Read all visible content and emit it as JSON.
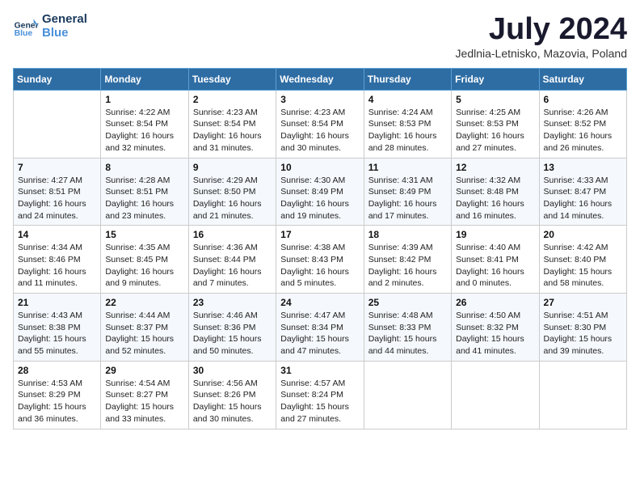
{
  "logo": {
    "line1": "General",
    "line2": "Blue"
  },
  "title": "July 2024",
  "location": "Jedlnia-Letnisko, Mazovia, Poland",
  "days_header": [
    "Sunday",
    "Monday",
    "Tuesday",
    "Wednesday",
    "Thursday",
    "Friday",
    "Saturday"
  ],
  "weeks": [
    [
      {
        "num": "",
        "info": ""
      },
      {
        "num": "1",
        "info": "Sunrise: 4:22 AM\nSunset: 8:54 PM\nDaylight: 16 hours\nand 32 minutes."
      },
      {
        "num": "2",
        "info": "Sunrise: 4:23 AM\nSunset: 8:54 PM\nDaylight: 16 hours\nand 31 minutes."
      },
      {
        "num": "3",
        "info": "Sunrise: 4:23 AM\nSunset: 8:54 PM\nDaylight: 16 hours\nand 30 minutes."
      },
      {
        "num": "4",
        "info": "Sunrise: 4:24 AM\nSunset: 8:53 PM\nDaylight: 16 hours\nand 28 minutes."
      },
      {
        "num": "5",
        "info": "Sunrise: 4:25 AM\nSunset: 8:53 PM\nDaylight: 16 hours\nand 27 minutes."
      },
      {
        "num": "6",
        "info": "Sunrise: 4:26 AM\nSunset: 8:52 PM\nDaylight: 16 hours\nand 26 minutes."
      }
    ],
    [
      {
        "num": "7",
        "info": "Sunrise: 4:27 AM\nSunset: 8:51 PM\nDaylight: 16 hours\nand 24 minutes."
      },
      {
        "num": "8",
        "info": "Sunrise: 4:28 AM\nSunset: 8:51 PM\nDaylight: 16 hours\nand 23 minutes."
      },
      {
        "num": "9",
        "info": "Sunrise: 4:29 AM\nSunset: 8:50 PM\nDaylight: 16 hours\nand 21 minutes."
      },
      {
        "num": "10",
        "info": "Sunrise: 4:30 AM\nSunset: 8:49 PM\nDaylight: 16 hours\nand 19 minutes."
      },
      {
        "num": "11",
        "info": "Sunrise: 4:31 AM\nSunset: 8:49 PM\nDaylight: 16 hours\nand 17 minutes."
      },
      {
        "num": "12",
        "info": "Sunrise: 4:32 AM\nSunset: 8:48 PM\nDaylight: 16 hours\nand 16 minutes."
      },
      {
        "num": "13",
        "info": "Sunrise: 4:33 AM\nSunset: 8:47 PM\nDaylight: 16 hours\nand 14 minutes."
      }
    ],
    [
      {
        "num": "14",
        "info": "Sunrise: 4:34 AM\nSunset: 8:46 PM\nDaylight: 16 hours\nand 11 minutes."
      },
      {
        "num": "15",
        "info": "Sunrise: 4:35 AM\nSunset: 8:45 PM\nDaylight: 16 hours\nand 9 minutes."
      },
      {
        "num": "16",
        "info": "Sunrise: 4:36 AM\nSunset: 8:44 PM\nDaylight: 16 hours\nand 7 minutes."
      },
      {
        "num": "17",
        "info": "Sunrise: 4:38 AM\nSunset: 8:43 PM\nDaylight: 16 hours\nand 5 minutes."
      },
      {
        "num": "18",
        "info": "Sunrise: 4:39 AM\nSunset: 8:42 PM\nDaylight: 16 hours\nand 2 minutes."
      },
      {
        "num": "19",
        "info": "Sunrise: 4:40 AM\nSunset: 8:41 PM\nDaylight: 16 hours\nand 0 minutes."
      },
      {
        "num": "20",
        "info": "Sunrise: 4:42 AM\nSunset: 8:40 PM\nDaylight: 15 hours\nand 58 minutes."
      }
    ],
    [
      {
        "num": "21",
        "info": "Sunrise: 4:43 AM\nSunset: 8:38 PM\nDaylight: 15 hours\nand 55 minutes."
      },
      {
        "num": "22",
        "info": "Sunrise: 4:44 AM\nSunset: 8:37 PM\nDaylight: 15 hours\nand 52 minutes."
      },
      {
        "num": "23",
        "info": "Sunrise: 4:46 AM\nSunset: 8:36 PM\nDaylight: 15 hours\nand 50 minutes."
      },
      {
        "num": "24",
        "info": "Sunrise: 4:47 AM\nSunset: 8:34 PM\nDaylight: 15 hours\nand 47 minutes."
      },
      {
        "num": "25",
        "info": "Sunrise: 4:48 AM\nSunset: 8:33 PM\nDaylight: 15 hours\nand 44 minutes."
      },
      {
        "num": "26",
        "info": "Sunrise: 4:50 AM\nSunset: 8:32 PM\nDaylight: 15 hours\nand 41 minutes."
      },
      {
        "num": "27",
        "info": "Sunrise: 4:51 AM\nSunset: 8:30 PM\nDaylight: 15 hours\nand 39 minutes."
      }
    ],
    [
      {
        "num": "28",
        "info": "Sunrise: 4:53 AM\nSunset: 8:29 PM\nDaylight: 15 hours\nand 36 minutes."
      },
      {
        "num": "29",
        "info": "Sunrise: 4:54 AM\nSunset: 8:27 PM\nDaylight: 15 hours\nand 33 minutes."
      },
      {
        "num": "30",
        "info": "Sunrise: 4:56 AM\nSunset: 8:26 PM\nDaylight: 15 hours\nand 30 minutes."
      },
      {
        "num": "31",
        "info": "Sunrise: 4:57 AM\nSunset: 8:24 PM\nDaylight: 15 hours\nand 27 minutes."
      },
      {
        "num": "",
        "info": ""
      },
      {
        "num": "",
        "info": ""
      },
      {
        "num": "",
        "info": ""
      }
    ]
  ]
}
